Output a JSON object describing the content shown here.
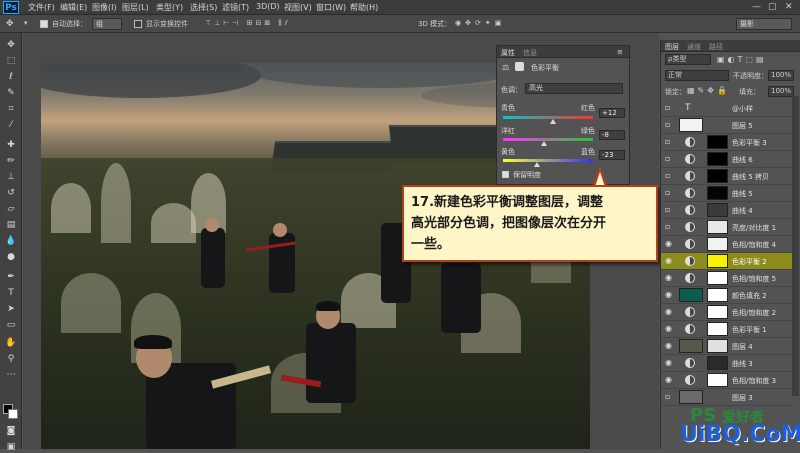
{
  "menubar": {
    "logo": "Ps",
    "items": [
      "文件(F)",
      "编辑(E)",
      "图像(I)",
      "图层(L)",
      "类型(Y)",
      "选择(S)",
      "滤镜(T)",
      "3D(D)",
      "视图(V)",
      "窗口(W)",
      "帮助(H)"
    ],
    "window_controls": [
      "—",
      "▢",
      "✕"
    ]
  },
  "options": {
    "auto_select_label": "自动选择：",
    "auto_select_value": "组",
    "show_transform_label": "显示变换控件",
    "mode_3d": "3D 模式：",
    "workspace": "摄影"
  },
  "properties": {
    "tabs": [
      "属性",
      "信息"
    ],
    "title": "色彩平衡",
    "tone_label": "色调：",
    "tone_value": "高光",
    "sliders": [
      {
        "left": "青色",
        "right": "红色",
        "value": "+12",
        "pos": 0.56,
        "gradient": "linear-gradient(90deg,#00c8c8,#ff3030)"
      },
      {
        "left": "洋红",
        "right": "绿色",
        "value": "-8",
        "pos": 0.46,
        "gradient": "linear-gradient(90deg,#ff30ff,#30c030)"
      },
      {
        "left": "黄色",
        "right": "蓝色",
        "value": "-23",
        "pos": 0.38,
        "gradient": "linear-gradient(90deg,#ffff30,#3030ff)"
      }
    ],
    "preserve_luminosity": "保留明度"
  },
  "callout": {
    "line1": "17.新建色彩平衡调整图层，调整",
    "line2": "高光部分色调，把图像层次在分开",
    "line3": "一些。"
  },
  "layers": {
    "tabs": [
      "图层",
      "通道",
      "路径"
    ],
    "kind_filter": "ρ类型",
    "blend_mode": "正常",
    "opacity_label": "不透明度：",
    "opacity_value": "100%",
    "lock_label": "锁定：",
    "fill_label": "填充：",
    "fill_value": "100%",
    "items": [
      {
        "name": "@小样",
        "type": "text",
        "visible": false
      },
      {
        "name": "图层 5",
        "type": "pixel",
        "visible": false,
        "thumb": "#f2f2f2"
      },
      {
        "name": "色彩平衡 3",
        "type": "adjust",
        "visible": false,
        "mask": "#000000"
      },
      {
        "name": "曲线 6",
        "type": "adjust",
        "visible": false,
        "mask": "#000000"
      },
      {
        "name": "曲线 5 拷贝",
        "type": "adjust",
        "visible": false,
        "mask": "#000000"
      },
      {
        "name": "曲线 5",
        "type": "adjust",
        "visible": false,
        "mask": "#050505"
      },
      {
        "name": "曲线 4",
        "type": "adjust",
        "visible": false,
        "mask": "#3a3a3a"
      },
      {
        "name": "亮度/对比度 1",
        "type": "adjust",
        "visible": false,
        "mask": "#e8e8e8"
      },
      {
        "name": "色相/饱和度 4",
        "type": "adjust",
        "visible": true,
        "mask": "#f2f2f2"
      },
      {
        "name": "色彩平衡 2",
        "type": "adjust",
        "visible": true,
        "mask": "#f7f200",
        "selected": true
      },
      {
        "name": "色相/饱和度 5",
        "type": "adjust",
        "visible": true,
        "mask": "#ffffff"
      },
      {
        "name": "颜色填充 2",
        "type": "fill",
        "visible": true,
        "mask": "#ffffff",
        "thumb": "#0d5c50"
      },
      {
        "name": "色相/饱和度 2",
        "type": "adjust",
        "visible": true,
        "mask": "#ffffff"
      },
      {
        "name": "色彩平衡 1",
        "type": "adjust",
        "visible": true,
        "mask": "#ffffff"
      },
      {
        "name": "图层 4",
        "type": "pixel",
        "visible": true,
        "thumb": "#555a48",
        "mask": "#e0e0e0"
      },
      {
        "name": "曲线 3",
        "type": "adjust",
        "visible": true,
        "mask": "#2a2a2a"
      },
      {
        "name": "色相/饱和度 3",
        "type": "adjust",
        "visible": true,
        "mask": "#ffffff"
      },
      {
        "name": "图层 3",
        "type": "pixel",
        "visible": false,
        "thumb": "#6a6a6a"
      }
    ]
  },
  "watermark": {
    "brand": "PS",
    "sub": "爱好者",
    "site": "UiBQ.CoM"
  },
  "colors": {
    "accent": "#b3401c",
    "selected_layer": "#8c8c1e",
    "callout_bg": "#fff6c8"
  }
}
